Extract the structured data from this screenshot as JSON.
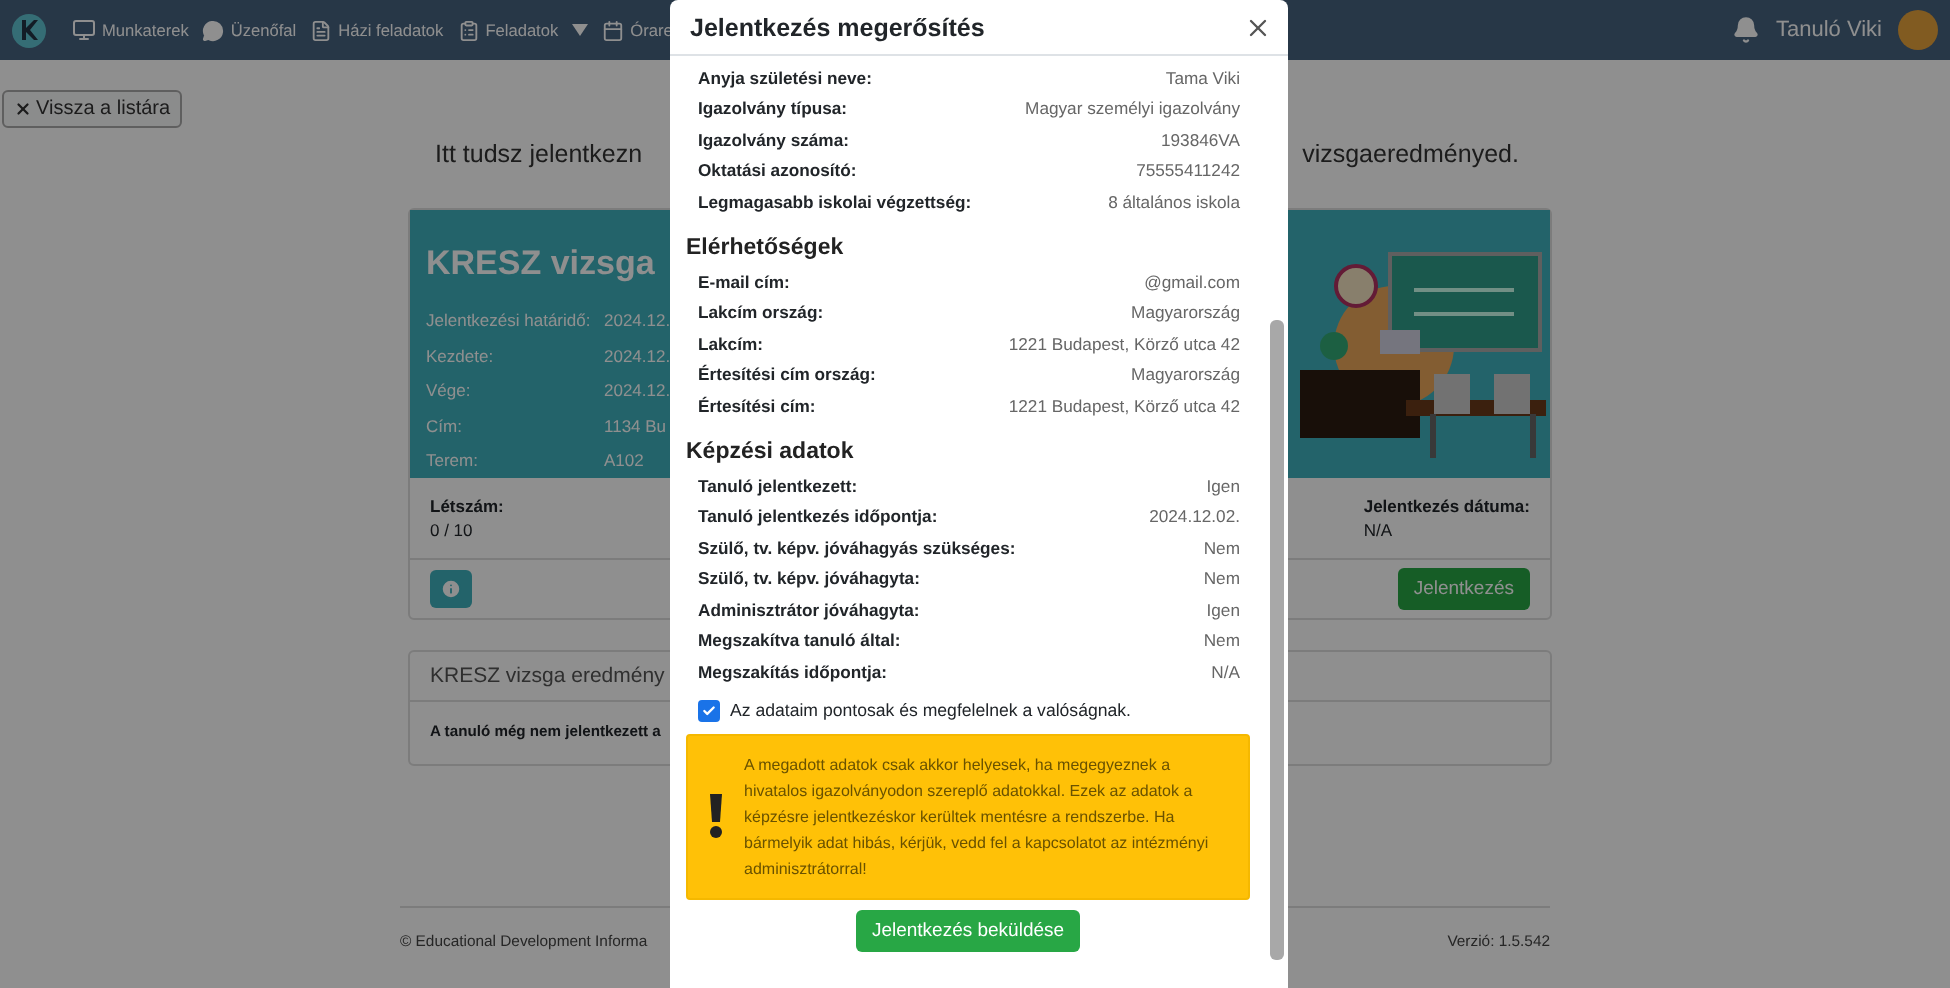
{
  "navbar": {
    "items": [
      {
        "label": "Munkaterek",
        "kind": "monitor"
      },
      {
        "label": "Üzenőfal",
        "kind": "chat"
      },
      {
        "label": "Házi feladatok",
        "kind": "file"
      },
      {
        "label": "Feladatok",
        "kind": "dropdown"
      },
      {
        "label": "Órare",
        "kind": "calendar"
      }
    ],
    "user": "Tanuló Viki"
  },
  "back_button": "Vissza a listára",
  "intro": [
    "Itt tudsz jelentkezn",
    "vizsgaeredményed."
  ],
  "exam_card": {
    "title": "KRESZ vizsga",
    "details": [
      {
        "label": "Jelentkezési határidő:",
        "value": "2024.12."
      },
      {
        "label": "Kezdete:",
        "value": "2024.12."
      },
      {
        "label": "Vége:",
        "value": "2024.12."
      },
      {
        "label": "Cím:",
        "value": "1134 Bu"
      },
      {
        "label": "Terem:",
        "value": "A102"
      }
    ],
    "stats": [
      {
        "label": "Létszám:",
        "value": "0 / 10"
      },
      {
        "label": "Jelentkezés dátuma:",
        "value": "N/A"
      }
    ],
    "apply_button": "Jelentkezés"
  },
  "results_card": {
    "title": "KRESZ vizsga eredmény",
    "message": "A tanuló még nem jelentkezett a"
  },
  "footer": {
    "copyright": "© Educational Development Informa",
    "version": "Verzió: 1.5.542"
  },
  "modal": {
    "title": "Jelentkezés megerősítés",
    "sections": [
      {
        "rows": [
          {
            "label": "Anyja születési neve:",
            "value": "Tama Viki"
          },
          {
            "label": "Igazolvány típusa:",
            "value": "Magyar személyi igazolvány"
          },
          {
            "label": "Igazolvány száma:",
            "value": "193846VA"
          },
          {
            "label": "Oktatási azonosító:",
            "value": "75555411242"
          },
          {
            "label": "Legmagasabb iskolai végzettség:",
            "value": "8 általános iskola"
          }
        ]
      },
      {
        "heading": "Elérhetőségek",
        "rows": [
          {
            "label": "E-mail cím:",
            "value": "@gmail.com"
          },
          {
            "label": "Lakcím ország:",
            "value": "Magyarország"
          },
          {
            "label": "Lakcím:",
            "value": "1221 Budapest, Körző utca 42"
          },
          {
            "label": "Értesítési cím ország:",
            "value": "Magyarország"
          },
          {
            "label": "Értesítési cím:",
            "value": "1221 Budapest, Körző utca 42"
          }
        ]
      },
      {
        "heading": "Képzési adatok",
        "rows": [
          {
            "label": "Tanuló jelentkezett:",
            "value": "Igen"
          },
          {
            "label": "Tanuló jelentkezés időpontja:",
            "value": "2024.12.02."
          },
          {
            "label": "Szülő, tv. képv. jóváhagyás szükséges:",
            "value": "Nem"
          },
          {
            "label": "Szülő, tv. képv. jóváhagyta:",
            "value": "Nem"
          },
          {
            "label": "Adminisztrátor jóváhagyta:",
            "value": "Igen"
          },
          {
            "label": "Megszakítva tanuló által:",
            "value": "Nem"
          },
          {
            "label": "Megszakítás időpontja:",
            "value": "N/A"
          }
        ]
      }
    ],
    "confirm": {
      "label": "Az adataim pontosak és megfelelnek a valóságnak.",
      "checked": true
    },
    "alert": "A megadott adatok csak akkor helyesek, ha megegyeznek a hivatalos igazolványodon szereplő adatokkal. Ezek az adatok a képzésre jelentkezéskor kerültek mentésre a rendszerbe. Ha bármelyik adat hibás, kérjük, vedd fel a kapcsolatot az intézményi adminisztrátorral!",
    "submit_button": "Jelentkezés beküldése"
  }
}
